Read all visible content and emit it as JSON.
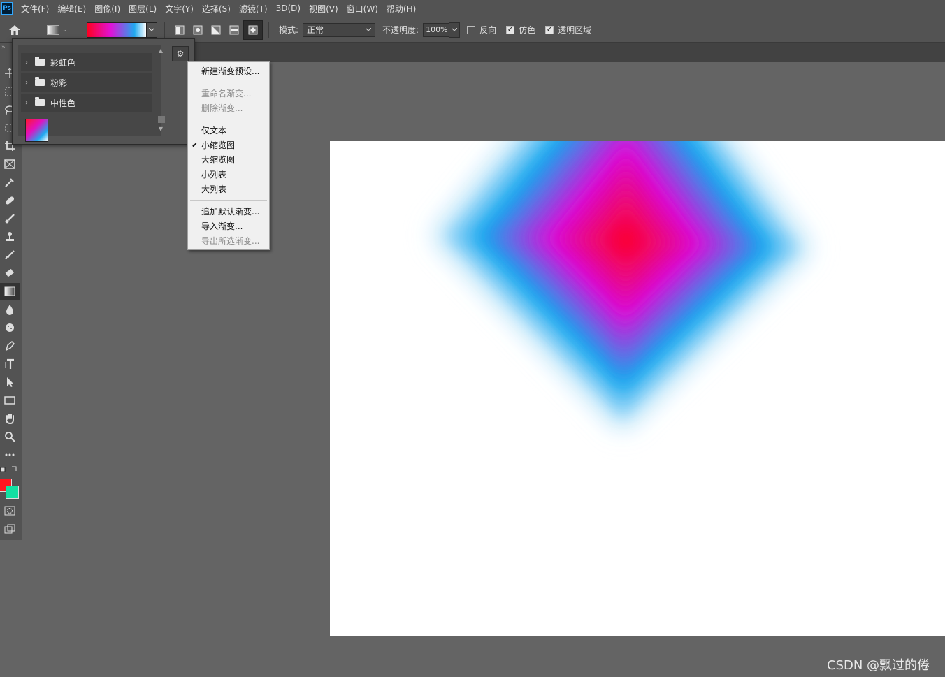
{
  "menubar": {
    "logo": "Ps",
    "items": [
      "文件(F)",
      "编辑(E)",
      "图像(I)",
      "图层(L)",
      "文字(Y)",
      "选择(S)",
      "滤镜(T)",
      "3D(D)",
      "视图(V)",
      "窗口(W)",
      "帮助(H)"
    ]
  },
  "options": {
    "mode_label": "模式:",
    "mode_value": "正常",
    "opacity_label": "不透明度:",
    "opacity_value": "100%",
    "reverse_label": "反向",
    "reverse_checked": false,
    "dither_label": "仿色",
    "dither_checked": true,
    "transparency_label": "透明区域",
    "transparency_checked": true,
    "gradient_colors": [
      "#ff0022",
      "#e012d8",
      "#1fa9ef",
      "#ffffff"
    ],
    "active_gradient_type": "diamond"
  },
  "gradient_panel": {
    "folders": [
      "彩虹色",
      "粉彩",
      "中性色"
    ]
  },
  "context_menu": {
    "items": [
      {
        "label": "新建渐变预设...",
        "enabled": true,
        "checked": false
      },
      {
        "label": "重命名渐变...",
        "enabled": false,
        "checked": false
      },
      {
        "label": "删除渐变...",
        "enabled": false,
        "checked": false
      },
      {
        "label": "仅文本",
        "enabled": true,
        "checked": false
      },
      {
        "label": "小缩览图",
        "enabled": true,
        "checked": true
      },
      {
        "label": "大缩览图",
        "enabled": true,
        "checked": false
      },
      {
        "label": "小列表",
        "enabled": true,
        "checked": false
      },
      {
        "label": "大列表",
        "enabled": true,
        "checked": false
      },
      {
        "label": "追加默认渐变...",
        "enabled": true,
        "checked": false
      },
      {
        "label": "导入渐变...",
        "enabled": true,
        "checked": false
      },
      {
        "label": "导出所选渐变...",
        "enabled": false,
        "checked": false
      }
    ]
  },
  "colors": {
    "foreground": "#ff1620",
    "background": "#12e0a2",
    "diamond_stops": [
      "#ff0022",
      "#d812d8",
      "#1aa6ee",
      "#ffffff"
    ]
  },
  "watermark": "CSDN @飘过的倦"
}
